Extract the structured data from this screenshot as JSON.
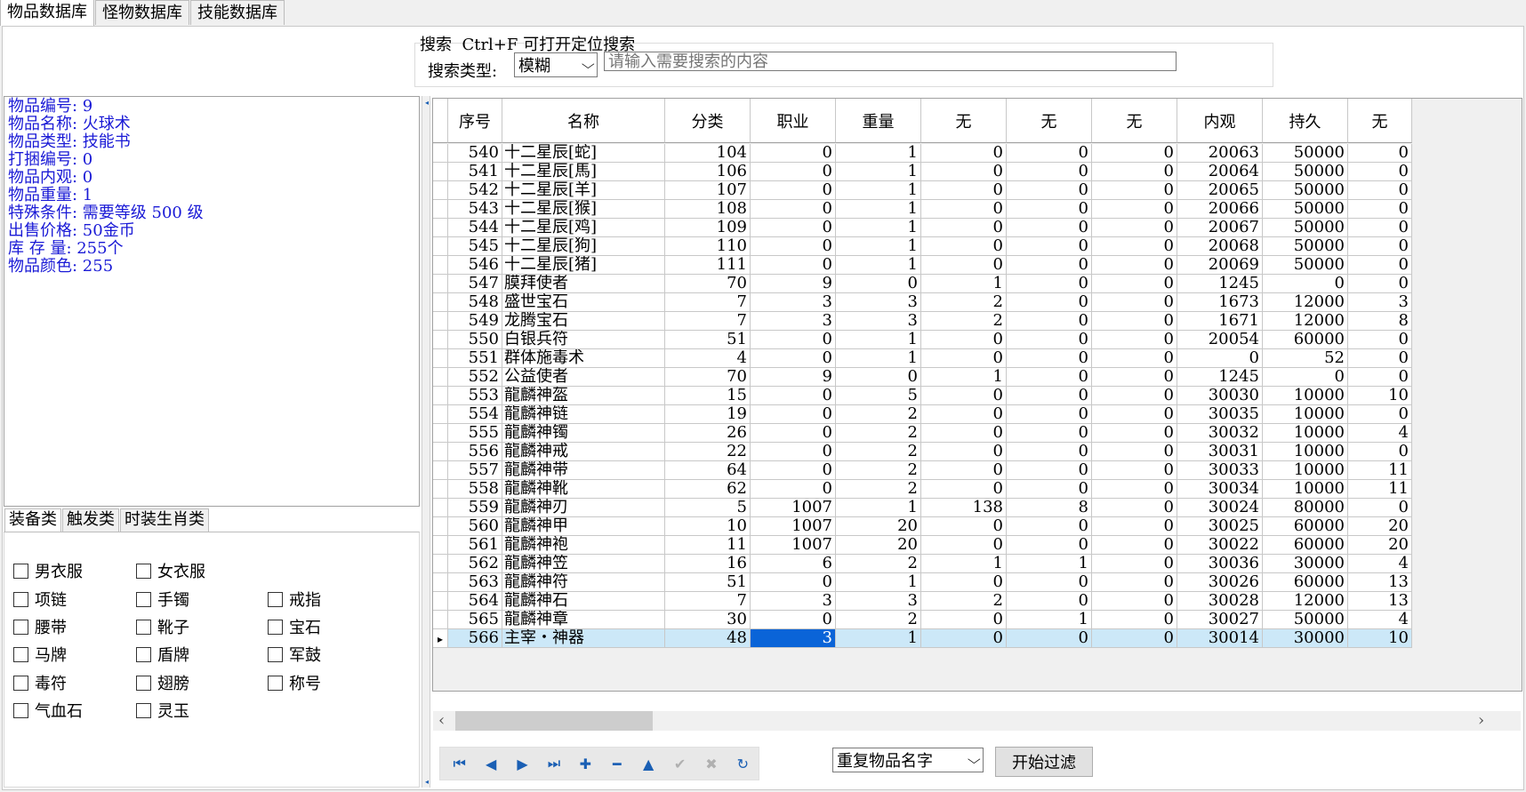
{
  "top_tabs": [
    "物品数据库",
    "怪物数据库",
    "技能数据库"
  ],
  "search": {
    "title": "搜索  Ctrl+F 可打开定位搜索",
    "type_label": "搜索类型:",
    "type_value": "模糊",
    "placeholder": "请输入需要搜索的内容"
  },
  "item_info": [
    "物品编号: 9",
    "物品名称: 火球术",
    "物品类型: 技能书",
    "打捆编号: 0",
    "物品内观: 0",
    "物品重量: 1",
    "特殊条件: 需要等级 500 级",
    "出售价格: 50金币",
    "库 存 量: 255个",
    "物品颜色: 255"
  ],
  "category_tabs": [
    "装备类",
    "触发类",
    "时装生肖类"
  ],
  "checkboxes": [
    [
      "男衣服",
      "女衣服",
      ""
    ],
    [
      "项链",
      "手镯",
      "戒指"
    ],
    [
      "腰带",
      "靴子",
      "宝石"
    ],
    [
      "马牌",
      "盾牌",
      "军鼓"
    ],
    [
      "毒符",
      "翅膀",
      "称号"
    ],
    [
      "气血石",
      "灵玉",
      ""
    ]
  ],
  "grid": {
    "columns": [
      "序号",
      "名称",
      "分类",
      "职业",
      "重量",
      "无",
      "无",
      "无",
      "内观",
      "持久",
      "无"
    ],
    "rows": [
      [
        "540",
        "十二星辰[蛇]",
        "104",
        "0",
        "1",
        "0",
        "0",
        "0",
        "20063",
        "50000",
        "0"
      ],
      [
        "541",
        "十二星辰[馬]",
        "106",
        "0",
        "1",
        "0",
        "0",
        "0",
        "20064",
        "50000",
        "0"
      ],
      [
        "542",
        "十二星辰[羊]",
        "107",
        "0",
        "1",
        "0",
        "0",
        "0",
        "20065",
        "50000",
        "0"
      ],
      [
        "543",
        "十二星辰[猴]",
        "108",
        "0",
        "1",
        "0",
        "0",
        "0",
        "20066",
        "50000",
        "0"
      ],
      [
        "544",
        "十二星辰[鸡]",
        "109",
        "0",
        "1",
        "0",
        "0",
        "0",
        "20067",
        "50000",
        "0"
      ],
      [
        "545",
        "十二星辰[狗]",
        "110",
        "0",
        "1",
        "0",
        "0",
        "0",
        "20068",
        "50000",
        "0"
      ],
      [
        "546",
        "十二星辰[猪]",
        "111",
        "0",
        "1",
        "0",
        "0",
        "0",
        "20069",
        "50000",
        "0"
      ],
      [
        "547",
        "膜拜使者",
        "70",
        "9",
        "0",
        "1",
        "0",
        "0",
        "1245",
        "0",
        "0"
      ],
      [
        "548",
        "盛世宝石",
        "7",
        "3",
        "3",
        "2",
        "0",
        "0",
        "1673",
        "12000",
        "3"
      ],
      [
        "549",
        "龙腾宝石",
        "7",
        "3",
        "3",
        "2",
        "0",
        "0",
        "1671",
        "12000",
        "8"
      ],
      [
        "550",
        "白银兵符",
        "51",
        "0",
        "1",
        "0",
        "0",
        "0",
        "20054",
        "60000",
        "0"
      ],
      [
        "551",
        "群体施毒术",
        "4",
        "0",
        "1",
        "0",
        "0",
        "0",
        "0",
        "52",
        "0"
      ],
      [
        "552",
        "公益使者",
        "70",
        "9",
        "0",
        "1",
        "0",
        "0",
        "1245",
        "0",
        "0"
      ],
      [
        "553",
        "龍麟神盔",
        "15",
        "0",
        "5",
        "0",
        "0",
        "0",
        "30030",
        "10000",
        "10"
      ],
      [
        "554",
        "龍麟神链",
        "19",
        "0",
        "2",
        "0",
        "0",
        "0",
        "30035",
        "10000",
        "0"
      ],
      [
        "555",
        "龍麟神镯",
        "26",
        "0",
        "2",
        "0",
        "0",
        "0",
        "30032",
        "10000",
        "4"
      ],
      [
        "556",
        "龍麟神戒",
        "22",
        "0",
        "2",
        "0",
        "0",
        "0",
        "30031",
        "10000",
        "0"
      ],
      [
        "557",
        "龍麟神带",
        "64",
        "0",
        "2",
        "0",
        "0",
        "0",
        "30033",
        "10000",
        "11"
      ],
      [
        "558",
        "龍麟神靴",
        "62",
        "0",
        "2",
        "0",
        "0",
        "0",
        "30034",
        "10000",
        "11"
      ],
      [
        "559",
        "龍麟神刃",
        "5",
        "1007",
        "1",
        "138",
        "8",
        "0",
        "30024",
        "80000",
        "0"
      ],
      [
        "560",
        "龍麟神甲",
        "10",
        "1007",
        "20",
        "0",
        "0",
        "0",
        "30025",
        "60000",
        "20"
      ],
      [
        "561",
        "龍麟神袍",
        "11",
        "1007",
        "20",
        "0",
        "0",
        "0",
        "30022",
        "60000",
        "20"
      ],
      [
        "562",
        "龍麟神笠",
        "16",
        "6",
        "2",
        "1",
        "1",
        "0",
        "30036",
        "30000",
        "4"
      ],
      [
        "563",
        "龍麟神符",
        "51",
        "0",
        "1",
        "0",
        "0",
        "0",
        "30026",
        "60000",
        "13"
      ],
      [
        "564",
        "龍麟神石",
        "7",
        "3",
        "3",
        "2",
        "0",
        "0",
        "30028",
        "12000",
        "13"
      ],
      [
        "565",
        "龍麟神章",
        "30",
        "0",
        "2",
        "0",
        "1",
        "0",
        "30027",
        "50000",
        "4"
      ],
      [
        "566",
        "主宰・神器",
        "48",
        "3",
        "1",
        "0",
        "0",
        "0",
        "30014",
        "30000",
        "10"
      ]
    ],
    "selected_row": 26,
    "current_column": 3
  },
  "navigator": {
    "buttons": [
      {
        "name": "first-record-icon",
        "glyph": "⏮",
        "enabled": true
      },
      {
        "name": "prior-record-icon",
        "glyph": "◀",
        "enabled": true
      },
      {
        "name": "next-record-icon",
        "glyph": "▶",
        "enabled": true
      },
      {
        "name": "last-record-icon",
        "glyph": "⏭",
        "enabled": true
      },
      {
        "name": "insert-record-icon",
        "glyph": "✚",
        "enabled": true
      },
      {
        "name": "delete-record-icon",
        "glyph": "━",
        "enabled": true
      },
      {
        "name": "edit-record-icon",
        "glyph": "▲",
        "enabled": true
      },
      {
        "name": "post-record-icon",
        "glyph": "✔",
        "enabled": false
      },
      {
        "name": "cancel-record-icon",
        "glyph": "✖",
        "enabled": false
      },
      {
        "name": "refresh-icon",
        "glyph": "↻",
        "enabled": true
      }
    ]
  },
  "filter": {
    "select_value": "重复物品名字",
    "button_label": "开始过滤"
  }
}
